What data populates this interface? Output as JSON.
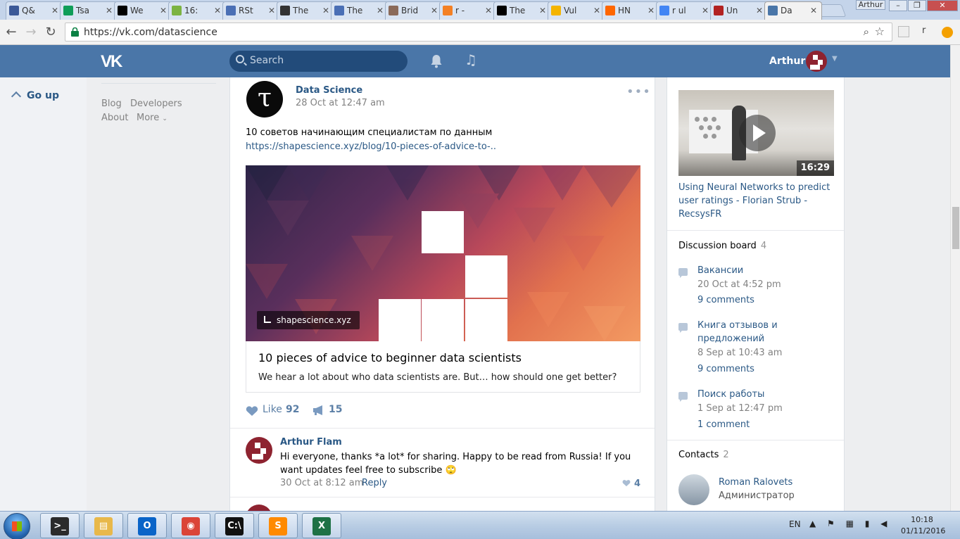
{
  "browser": {
    "tabs": [
      {
        "label": "Q&",
        "icon": "quora-icon",
        "color": "#3b5998"
      },
      {
        "label": "Tsa",
        "icon": "sheets-icon",
        "color": "#0f9d58"
      },
      {
        "label": "We",
        "icon": "digg-icon",
        "color": "#000000"
      },
      {
        "label": "16:",
        "icon": "smiley-icon",
        "color": "#7cb342"
      },
      {
        "label": "RSt",
        "icon": "rstudio-icon",
        "color": "#4a6fb5"
      },
      {
        "label": "The",
        "icon": "grid-icon",
        "color": "#333333"
      },
      {
        "label": "The",
        "icon": "globe-icon",
        "color": "#4a6fb5"
      },
      {
        "label": "Brid",
        "icon": "photo-icon",
        "color": "#8a6a5a"
      },
      {
        "label": "r -",
        "icon": "stackoverflow-icon",
        "color": "#f48024"
      },
      {
        "label": "The",
        "icon": "star-icon",
        "color": "#000000"
      },
      {
        "label": "Vul",
        "icon": "chart-icon",
        "color": "#f4b400"
      },
      {
        "label": "HN",
        "icon": "timer-icon",
        "color": "#ff6600"
      },
      {
        "label": "r ul",
        "icon": "google-icon",
        "color": "#4285f4"
      },
      {
        "label": "Un",
        "icon": "r-icon",
        "color": "#b22222"
      },
      {
        "label": "Da",
        "icon": "vk-icon",
        "color": "#4a76a8",
        "active": true
      }
    ],
    "window_user": "Arthur",
    "url": "https://vk.com/datascience",
    "ext_letter": "r"
  },
  "header": {
    "logo": "VK",
    "search_placeholder": "Search",
    "user_name": "Arthur"
  },
  "left": {
    "go_up": "Go up",
    "links": [
      "Blog",
      "Developers",
      "About",
      "More"
    ]
  },
  "post": {
    "author": "Data Science",
    "date": "28 Oct at 12:47 am",
    "avatar_letter": "τ",
    "text": "10 советов начинающим специалистам по данным",
    "link": "https://shapescience.xyz/blog/10-pieces-of-advice-to-..",
    "site": "shapescience.xyz",
    "snippet_title": "10 pieces of advice to beginner data scientists",
    "snippet_desc": "We hear a lot about who data scientists are. But… how should one get better?",
    "like_label": "Like",
    "likes": "92",
    "shares": "15"
  },
  "comment": {
    "author": "Arthur Flam",
    "text": "Hi everyone, thanks *a lot* for sharing. Happy to be read from Russia! If you want updates feel free to subscribe 🙄",
    "date": "30 Oct at 8:12 am",
    "reply": "Reply",
    "likes": "4"
  },
  "sidebar": {
    "video_duration": "16:29",
    "video_title": "Using Neural Networks to predict user ratings - Florian Strub - RecsysFR",
    "discussion_label": "Discussion board",
    "discussion_count": "4",
    "topics": [
      {
        "title": "Вакансии",
        "date": "20 Oct at 4:52 pm",
        "comments": "9 comments"
      },
      {
        "title": "Книга отзывов и предложений",
        "date": "8 Sep at 10:43 am",
        "comments": "9 comments"
      },
      {
        "title": "Поиск работы",
        "date": "1 Sep at 12:47 pm",
        "comments": "1 comment"
      }
    ],
    "contacts_label": "Contacts",
    "contacts_count": "2",
    "contact_name": "Roman Ralovets",
    "contact_role": "Администратор"
  },
  "taskbar": {
    "apps": [
      {
        "name": "terminal-app-icon",
        "color": "#2b2b2b",
        "glyph": ">_"
      },
      {
        "name": "explorer-app-icon",
        "color": "#e8b84a",
        "glyph": "▤"
      },
      {
        "name": "outlook-app-icon",
        "color": "#0a64c8",
        "glyph": "O"
      },
      {
        "name": "chrome-app-icon",
        "color": "#db4437",
        "glyph": "◉"
      },
      {
        "name": "cmd-app-icon",
        "color": "#111111",
        "glyph": "C:\\"
      },
      {
        "name": "sublime-app-icon",
        "color": "#ff8a00",
        "glyph": "S"
      },
      {
        "name": "excel-app-icon",
        "color": "#1e7145",
        "glyph": "X"
      }
    ],
    "lang": "EN",
    "time": "10:18",
    "date": "01/11/2016"
  }
}
